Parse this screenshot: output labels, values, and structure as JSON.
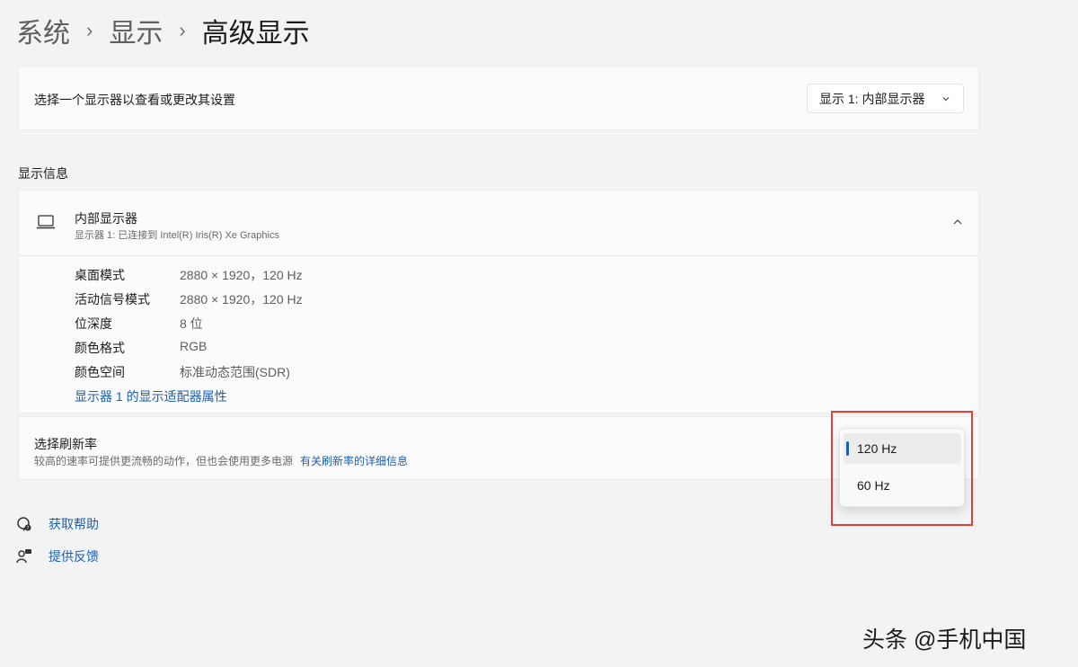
{
  "breadcrumb": {
    "items": [
      "系统",
      "显示",
      "高级显示"
    ],
    "separator": "›"
  },
  "select_display": {
    "text": "选择一个显示器以查看或更改其设置",
    "dropdown_value": "显示 1: 内部显示器"
  },
  "display_info": {
    "section_title": "显示信息",
    "display_name": "内部显示器",
    "display_subtitle": "显示器 1: 已连接到 Intel(R) Iris(R) Xe Graphics",
    "rows": [
      {
        "label": "桌面模式",
        "value": "2880 × 1920，120 Hz"
      },
      {
        "label": "活动信号模式",
        "value": "2880 × 1920，120 Hz"
      },
      {
        "label": "位深度",
        "value": "8 位"
      },
      {
        "label": "颜色格式",
        "value": "RGB"
      },
      {
        "label": "颜色空间",
        "value": "标准动态范围(SDR)"
      }
    ],
    "adapter_link": "显示器 1 的显示适配器属性"
  },
  "refresh_rate": {
    "title": "选择刷新率",
    "description": "较高的速率可提供更流畅的动作，但也会使用更多电源",
    "more_link": "有关刷新率的详细信息",
    "options": [
      "120 Hz",
      "60 Hz"
    ],
    "selected_index": 0
  },
  "footer": {
    "help": "获取帮助",
    "feedback": "提供反馈"
  },
  "watermark": "头条 @手机中国",
  "colors": {
    "accent": "#1d5fb0",
    "highlight": "#e0403a",
    "background": "#f3f3f3",
    "card": "#fbfbfb"
  },
  "icons": {
    "dropdown": "chevron-down-icon",
    "display": "laptop-icon",
    "collapse": "chevron-up-icon",
    "help": "help-icon",
    "feedback": "feedback-icon"
  }
}
